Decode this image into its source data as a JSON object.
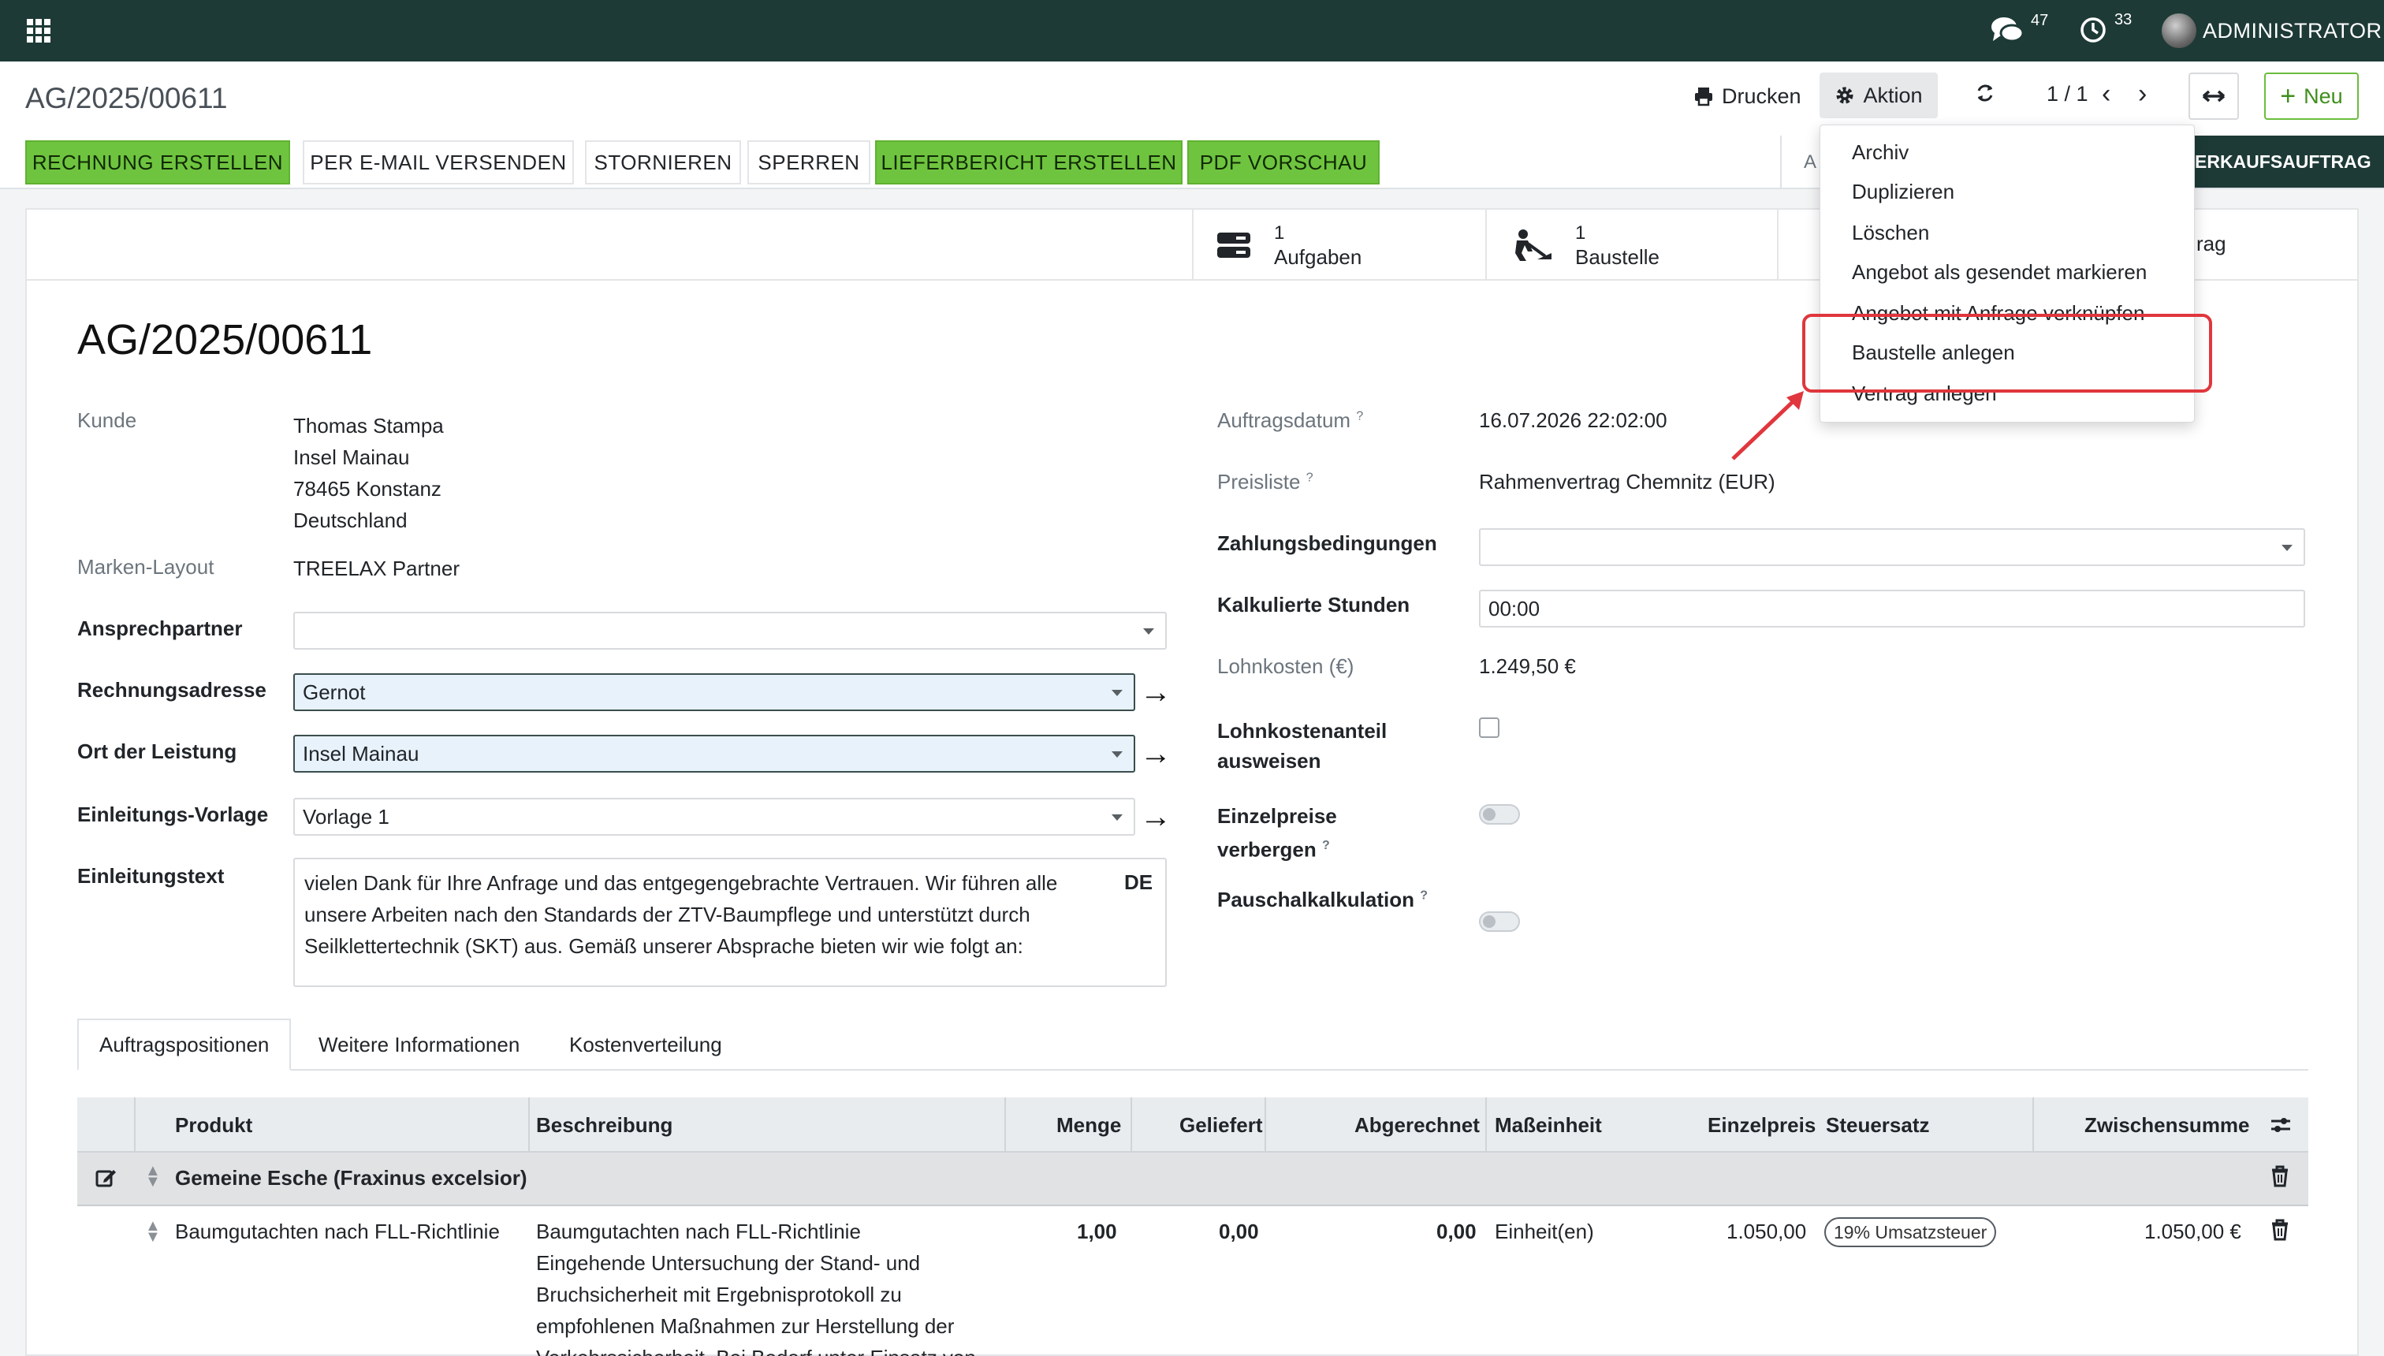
{
  "topnav": {
    "apps_icon": "apps-grid-icon",
    "messages_count": "47",
    "activities_count": "33",
    "user_name": "ADMINISTRATOR"
  },
  "control": {
    "breadcrumb": "AG/2025/00611",
    "print_label": "Drucken",
    "action_label": "Aktion",
    "pager": "1 / 1",
    "new_label": "Neu"
  },
  "statusbar": {
    "buttons": [
      "RECHNUNG ERSTELLEN",
      "PER E-MAIL VERSENDEN",
      "STORNIEREN",
      "SPERREN",
      "LIEFERBERICHT ERSTELLEN",
      "PDF VORSCHAU"
    ],
    "partial_left": "A",
    "stage_label": "ERKAUFSAUFTRAG"
  },
  "smart_buttons": [
    {
      "count": "1",
      "label": "Aufgaben"
    },
    {
      "count": "1",
      "label": "Baustelle"
    },
    {
      "count": "",
      "label": "rag"
    }
  ],
  "record": {
    "title": "AG/2025/00611",
    "left": {
      "kunde_label": "Kunde",
      "kunde_lines": [
        "Thomas Stampa",
        "Insel Mainau",
        "78465 Konstanz",
        "Deutschland"
      ],
      "marken_label": "Marken-Layout",
      "marken_value": "TREELAX Partner",
      "ansprech_label": "Ansprechpartner",
      "ansprech_value": "",
      "rechnung_label": "Rechnungsadresse",
      "rechnung_value": "Gernot",
      "ort_label": "Ort der Leistung",
      "ort_value": "Insel Mainau",
      "vorlage_label": "Einleitungs-Vorlage",
      "vorlage_value": "Vorlage 1",
      "text_label": "Einleitungstext",
      "text_lines": [
        "vielen Dank für Ihre Anfrage und das entgegengebrachte Vertrauen. Wir führen alle",
        "unsere Arbeiten nach den Standards der ZTV-Baumpflege und unterstützt durch",
        "Seilklettertechnik (SKT) aus. Gemäß unserer Absprache bieten wir wie folgt an:"
      ],
      "text_lang": "DE"
    },
    "right": {
      "datum_label": "Auftragsdatum",
      "datum_value": "16.07.2026 22:02:00",
      "preisliste_label": "Preisliste",
      "preisliste_value": "Rahmenvertrag Chemnitz (EUR)",
      "zahlung_label": "Zahlungsbedingungen",
      "zahlung_value": "",
      "stunden_label": "Kalkulierte Stunden",
      "stunden_value": "00:00",
      "lohn_label": "Lohnkosten (€)",
      "lohn_value": "1.249,50 €",
      "anteil_label_1": "Lohnkostenanteil",
      "anteil_label_2": "ausweisen",
      "einzel_label_1": "Einzelpreise",
      "einzel_label_2": "verbergen",
      "pauschal_label": "Pauschalkalkulation",
      "help_mark": "?"
    }
  },
  "tabs": [
    "Auftragspositionen",
    "Weitere Informationen",
    "Kostenverteilung"
  ],
  "table": {
    "headers": [
      "Produkt",
      "Beschreibung",
      "Menge",
      "Geliefert",
      "Abgerechnet",
      "Maßeinheit",
      "Einzelpreis",
      "Steuersatz",
      "Zwischensumme"
    ],
    "section_name": "Gemeine Esche (Fraxinus excelsior)",
    "row": {
      "product": "Baumgutachten nach FLL-Richtlinie",
      "description_lines": [
        "Baumgutachten nach FLL-Richtlinie",
        "Eingehende Untersuchung der Stand- und",
        "Bruchsicherheit mit Ergebnisprotokoll zu",
        "empfohlenen Maßnahmen zur Herstellung der",
        "Verkehrssicherheit. Bei Bedarf unter Einsatz von"
      ],
      "qty": "1,00",
      "delivered": "0,00",
      "invoiced": "0,00",
      "uom": "Einheit(en)",
      "price": "1.050,00",
      "tax": "19% Umsatzsteuer",
      "subtotal": "1.050,00 €"
    }
  },
  "action_menu": {
    "items": [
      "Archiv",
      "Duplizieren",
      "Löschen",
      "Angebot als gesendet markieren",
      "Angebot mit Anfrage verknüpfen",
      "Baustelle anlegen",
      "Vertrag anlegen"
    ],
    "highlight_color": "#e0363d"
  }
}
